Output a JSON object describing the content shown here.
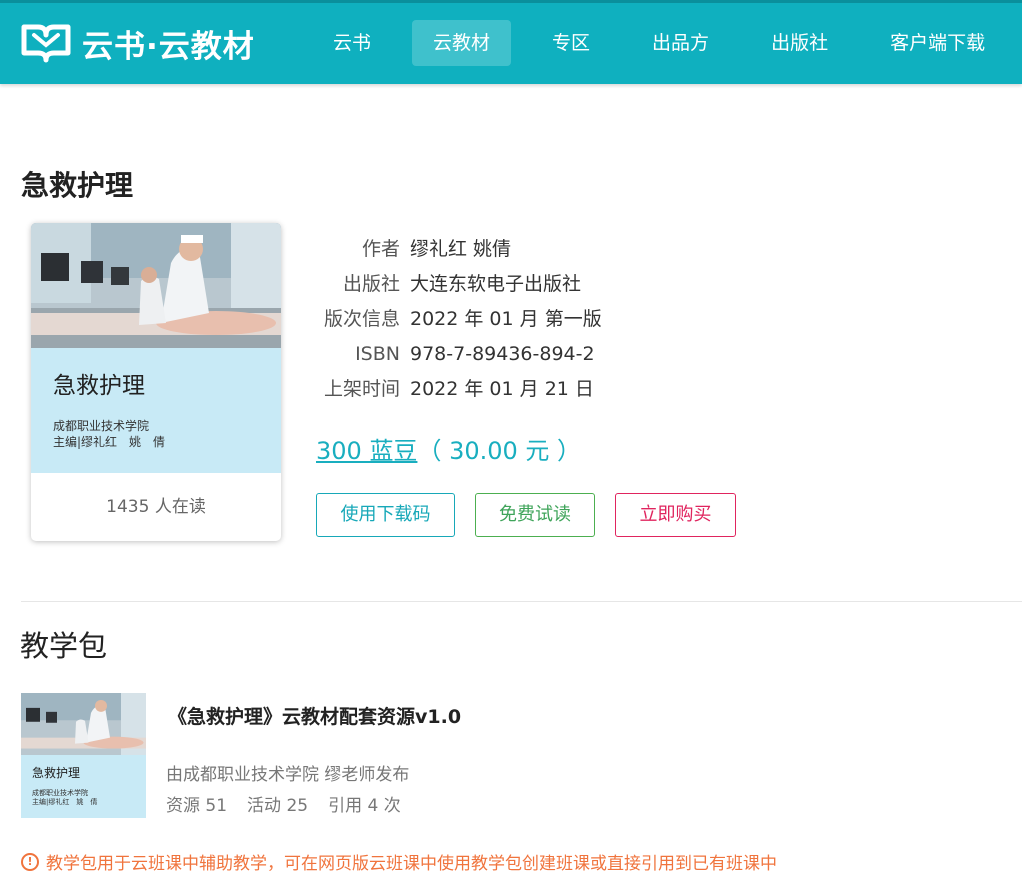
{
  "header": {
    "logo_text": "云书·云教材",
    "nav": [
      {
        "label": "云书"
      },
      {
        "label": "云教材"
      },
      {
        "label": "专区"
      },
      {
        "label": "出品方"
      },
      {
        "label": "出版社"
      },
      {
        "label": "客户端下载"
      }
    ],
    "active_nav": "云教材",
    "brand_color": "#0fb0bf"
  },
  "book": {
    "title": "急救护理",
    "cover": {
      "title": "急救护理",
      "school": "成都职业技术学院",
      "editor": "主编|缪礼红　姚　倩"
    },
    "readers": "1435 人在读",
    "info": [
      {
        "label": "作者",
        "value": "缪礼红 姚倩"
      },
      {
        "label": "出版社",
        "value": "大连东软电子出版社"
      },
      {
        "label": "版次信息",
        "value": "2022 年 01 月 第一版"
      },
      {
        "label": "ISBN",
        "value": "978-7-89436-894-2"
      },
      {
        "label": "上架时间",
        "value": "2022 年 01 月 21 日"
      }
    ],
    "price": {
      "beans": "300 蓝豆",
      "yuan": "（ 30.00 元 ）"
    },
    "buttons": {
      "download_code": "使用下载码",
      "free_trial": "免费试读",
      "buy_now": "立即购买"
    }
  },
  "teaching_package": {
    "section_title": "教学包",
    "thumb": {
      "title": "急救护理",
      "line1": "成都职业技术学院",
      "line2": "主编|缪礼红　姚　倩"
    },
    "name": "《急救护理》云教材配套资源v1.0",
    "publisher": "由成都职业技术学院 缪老师发布",
    "stats": {
      "resources": "资源 51",
      "activities": "活动 25",
      "citations": "引用 4 次"
    }
  },
  "notice": {
    "icon": "!",
    "text": "教学包用于云班课中辅助教学，可在网页版云班课中使用教学包创建班课或直接引用到已有班课中"
  }
}
